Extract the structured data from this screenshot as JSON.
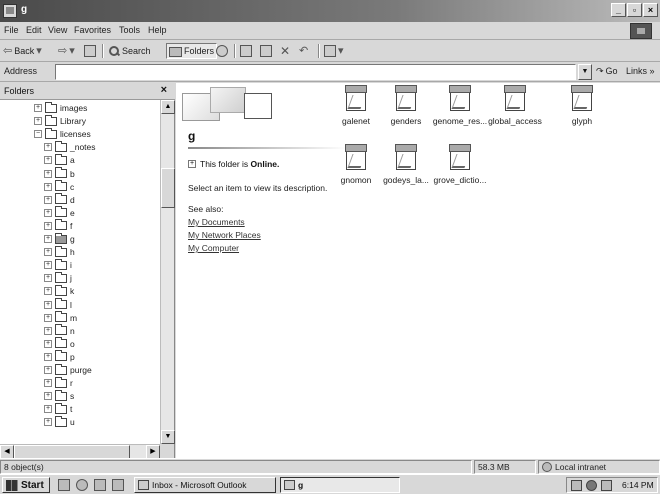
{
  "window": {
    "title": "g",
    "controls": [
      "_",
      "▫",
      "×"
    ]
  },
  "menu": [
    "File",
    "Edit",
    "View",
    "Favorites",
    "Tools",
    "Help"
  ],
  "toolbar": {
    "back": "Back",
    "search": "Search",
    "folders": "Folders"
  },
  "address": {
    "label": "Address",
    "value": "",
    "go": "Go",
    "links": "Links »"
  },
  "folders_pane": {
    "title": "Folders",
    "close": "×",
    "tree": [
      "images",
      "Library",
      "licenses",
      "_notes",
      "a",
      "b",
      "c",
      "d",
      "e",
      "f",
      "g",
      "h",
      "i",
      "j",
      "k",
      "l",
      "m",
      "n",
      "o",
      "p",
      "purge",
      "r",
      "s",
      "t",
      "u"
    ]
  },
  "details": {
    "folder_name": "g",
    "online_prefix": "This folder is ",
    "online_status": "Online.",
    "description": "Select an item to view its description.",
    "see_also": "See also:",
    "links": [
      "My Documents",
      "My Network Places",
      "My Computer"
    ]
  },
  "files": [
    "galenet",
    "genders",
    "genome_res...",
    "global_access",
    "glyph",
    "gnomon",
    "godeys_la...",
    "grove_dictio..."
  ],
  "status": {
    "objects": "8 object(s)",
    "size": "58.3 MB",
    "zone": "Local intranet"
  },
  "taskbar": {
    "start": "Start",
    "tasks": [
      "Inbox - Microsoft Outlook",
      "g"
    ],
    "clock": "6:14 PM"
  }
}
